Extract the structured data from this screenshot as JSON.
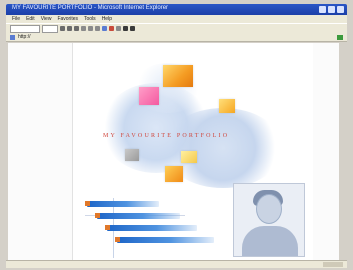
{
  "window": {
    "title": "MY FAVOURITE PORTFOLIO - Microsoft Internet Explorer"
  },
  "menubar": {
    "items": [
      "File",
      "Edit",
      "View",
      "Favorites",
      "Tools",
      "Help"
    ]
  },
  "addressbar": {
    "value": "http://"
  },
  "page": {
    "headline": "MY  FAVOURITE  PORTFOLIO",
    "bars": [
      {
        "level": 0.65
      },
      {
        "level": 0.75
      },
      {
        "level": 0.82
      },
      {
        "level": 0.88
      }
    ]
  },
  "colors": {
    "titlebar": "#1b3fa8",
    "headline": "#d0463c",
    "bar_blue": "#1e66c8",
    "bar_marker": "#e0782a"
  }
}
